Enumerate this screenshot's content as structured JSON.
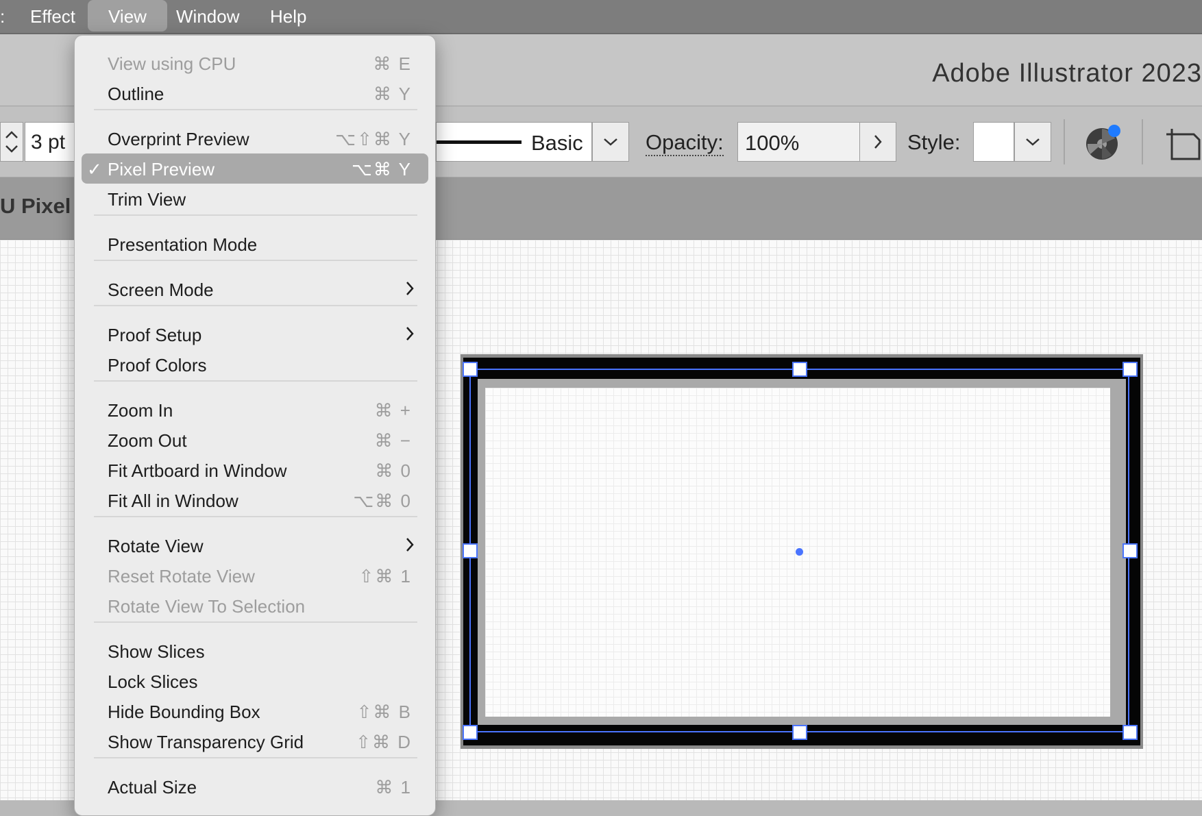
{
  "menubar": {
    "items": [
      {
        "label": ":"
      },
      {
        "label": "Effect"
      },
      {
        "label": "View"
      },
      {
        "label": "Window"
      },
      {
        "label": "Help"
      }
    ]
  },
  "app": {
    "title": "Adobe Illustrator 2023"
  },
  "controlbar": {
    "stroke_weight": "3 pt",
    "brush_label": "Basic",
    "opacity_label": "Opacity:",
    "opacity_value": "100%",
    "style_label": "Style:"
  },
  "document_tab": {
    "label": "U Pixel"
  },
  "view_menu": {
    "items": [
      {
        "label": "View using CPU",
        "shortcut": "⌘ E",
        "disabled": true
      },
      {
        "label": "Outline",
        "shortcut": "⌘ Y"
      },
      {
        "label": "Overprint Preview",
        "shortcut": "⌥⇧⌘ Y"
      },
      {
        "label": "Pixel Preview",
        "shortcut": "⌥⌘ Y",
        "checked": true,
        "selected": true
      },
      {
        "label": "Trim View",
        "shortcut": ""
      },
      {
        "label": "Presentation Mode",
        "shortcut": ""
      },
      {
        "label": "Screen Mode",
        "submenu": true
      },
      {
        "label": "Proof Setup",
        "submenu": true
      },
      {
        "label": "Proof Colors",
        "shortcut": ""
      },
      {
        "label": "Zoom In",
        "shortcut": "⌘ +"
      },
      {
        "label": "Zoom Out",
        "shortcut": "⌘ −"
      },
      {
        "label": "Fit Artboard in Window",
        "shortcut": "⌘ 0"
      },
      {
        "label": "Fit All in Window",
        "shortcut": "⌥⌘ 0"
      },
      {
        "label": "Rotate View",
        "submenu": true
      },
      {
        "label": "Reset Rotate View",
        "shortcut": "⇧⌘ 1",
        "disabled": true
      },
      {
        "label": "Rotate View To Selection",
        "shortcut": "",
        "disabled": true
      },
      {
        "label": "Show Slices",
        "shortcut": ""
      },
      {
        "label": "Lock Slices",
        "shortcut": ""
      },
      {
        "label": "Hide Bounding Box",
        "shortcut": "⇧⌘ B"
      },
      {
        "label": "Show Transparency Grid",
        "shortcut": "⇧⌘ D"
      },
      {
        "label": "Actual Size",
        "shortcut": "⌘ 1"
      }
    ],
    "check_glyph": "✓",
    "submenu_glyph": "›"
  },
  "icons": {
    "stepper": "stepper-icon",
    "chevron": "chevron-down-icon",
    "chevron_right": "chevron-right-icon",
    "recolor": "recolor-artwork-icon",
    "artboard": "artboard-icon"
  },
  "colors": {
    "selection": "#4a74ff",
    "menu_highlight": "#a9a9a9",
    "recolor_dot": "#1f7bff"
  }
}
